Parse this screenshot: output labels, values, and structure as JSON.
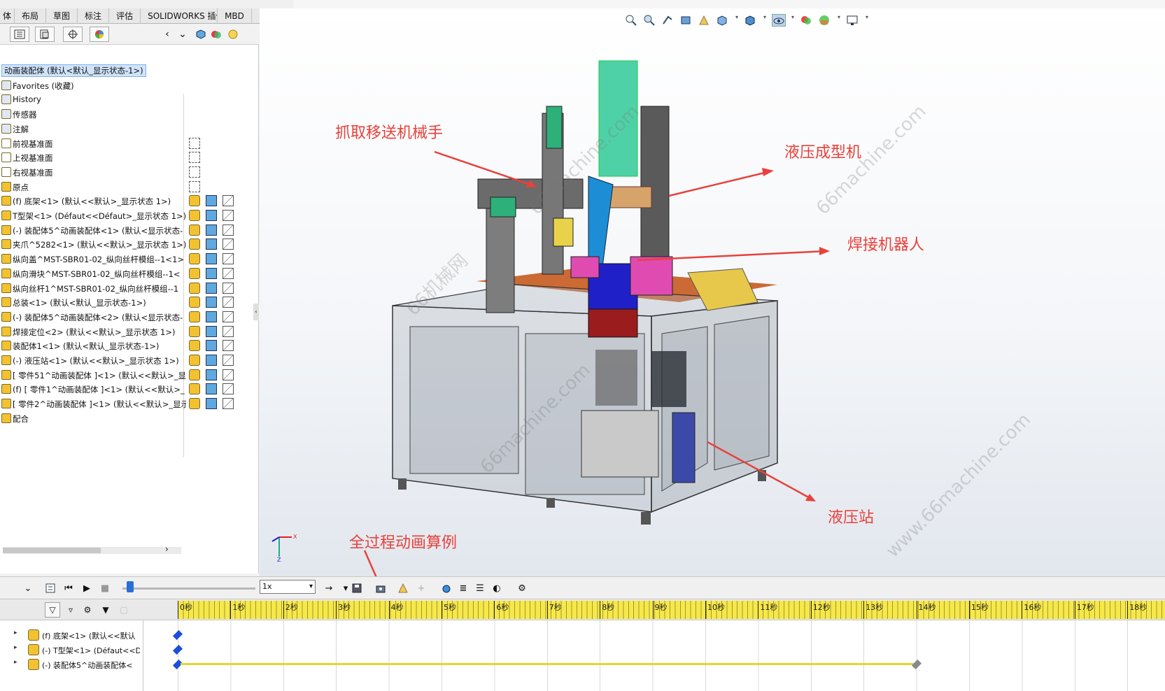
{
  "top_tabs": [
    "体",
    "布局",
    "草图",
    "标注",
    "评估",
    "SOLIDWORKS 插件",
    "MBD"
  ],
  "tree": {
    "root": "动画装配体 (默认<默认_显示状态-1>)",
    "items": [
      {
        "label": "Favorites (收藏)",
        "icon": "star-folder-icon"
      },
      {
        "label": "History",
        "icon": "history-icon"
      },
      {
        "label": "传感器",
        "icon": "sensor-icon"
      },
      {
        "label": "注解",
        "icon": "annotation-icon"
      },
      {
        "label": "前视基准面",
        "icon": "plane-icon"
      },
      {
        "label": "上视基准面",
        "icon": "plane-icon"
      },
      {
        "label": "右视基准面",
        "icon": "plane-icon"
      },
      {
        "label": "原点",
        "icon": "origin-icon"
      },
      {
        "label": "(f) 底架<1> (默认<<默认>_显示状态 1>)",
        "icon": "part-icon"
      },
      {
        "label": "T型架<1> (Défaut<<Défaut>_显示状态 1>)",
        "icon": "part-icon"
      },
      {
        "label": "(-) 装配体5^动画装配体<1> (默认<显示状态-",
        "icon": "subassembly-icon"
      },
      {
        "label": "夹爪^5282<1> (默认<<默认>_显示状态 1>)",
        "icon": "part-icon"
      },
      {
        "label": "纵向盖^MST-SBR01-02_纵向丝杆模组--1<1>",
        "icon": "part-icon"
      },
      {
        "label": "纵向滑块^MST-SBR01-02_纵向丝杆模组--1<",
        "icon": "part-icon"
      },
      {
        "label": "纵向丝杆1^MST-SBR01-02_纵向丝杆模组--1",
        "icon": "part-icon"
      },
      {
        "label": "总装<1> (默认<默认_显示状态-1>)",
        "icon": "subassembly-icon"
      },
      {
        "label": "(-) 装配体5^动画装配体<2> (默认<显示状态-",
        "icon": "subassembly-icon"
      },
      {
        "label": "焊接定位<2> (默认<<默认>_显示状态 1>)",
        "icon": "part-icon"
      },
      {
        "label": "装配体1<1> (默认<默认_显示状态-1>)",
        "icon": "subassembly-icon"
      },
      {
        "label": "(-) 液压站<1> (默认<<默认>_显示状态 1>)",
        "icon": "part-icon"
      },
      {
        "label": "[ 零件51^动画装配体 ]<1> (默认<<默认>_显",
        "icon": "part-icon"
      },
      {
        "label": "(f) [ 零件1^动画装配体 ]<1> (默认<<默认>_",
        "icon": "part-icon"
      },
      {
        "label": "[ 零件2^动画装配体 ]<1> (默认<<默认>_显示",
        "icon": "part-icon"
      },
      {
        "label": "配合",
        "icon": "mates-icon"
      }
    ]
  },
  "callouts": {
    "gripper_robot": "抓取移送机械手",
    "hydraulic_press": "液压成型机",
    "welding_robot": "焊接机器人",
    "hydraulic_station": "液压站",
    "full_animation": "全过程动画算例"
  },
  "watermarks": [
    "66machine.com",
    "www.66machine.com",
    "66机械网"
  ],
  "motion": {
    "speed": "1x",
    "ruler_labels": [
      "0秒",
      "1秒",
      "2秒",
      "3秒",
      "4秒",
      "5秒",
      "6秒",
      "7秒",
      "8秒",
      "9秒",
      "10秒",
      "11秒",
      "12秒",
      "13秒",
      "14秒",
      "15秒",
      "16秒",
      "17秒",
      "18秒"
    ],
    "rows": [
      {
        "label": "(f) 底架<1> (默认<<默认"
      },
      {
        "label": "(-) T型架<1> (Défaut<<D"
      },
      {
        "label": "(-) 装配体5^动画装配体<"
      }
    ]
  },
  "colors": {
    "callout": "#e8413b",
    "ruler": "#f7e84a",
    "selection": "#cfe3fb",
    "track": "#e6d62d"
  }
}
